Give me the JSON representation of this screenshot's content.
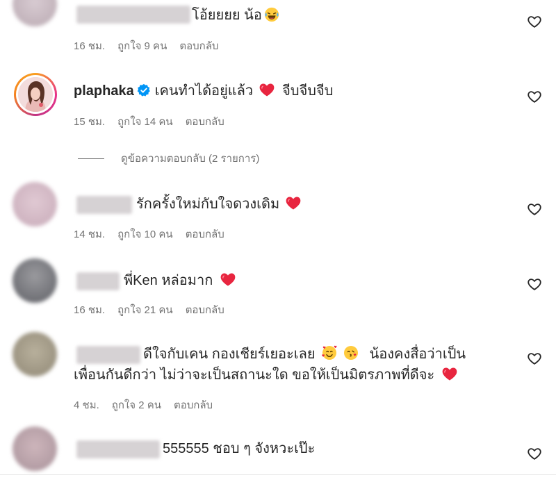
{
  "comments": [
    {
      "text": "โอ้ยยยย น้อ",
      "emoji_after": "laughing-tears",
      "time": "16 ชม.",
      "likes": "ถูกใจ 9 คน",
      "reply": "ตอบกลับ"
    },
    {
      "username": "plaphaka",
      "verified": true,
      "text": "เคนทำได้อยู่แล้ว",
      "text_after": "จีบจีบจีบ",
      "time": "15 ชม.",
      "likes": "ถูกใจ 14 คน",
      "reply": "ตอบกลับ",
      "view_replies": "ดูข้อความตอบกลับ (2 รายการ)"
    },
    {
      "text": "รักครั้งใหม่กับใจดวงเดิม",
      "time": "14 ชม.",
      "likes": "ถูกใจ 10 คน",
      "reply": "ตอบกลับ"
    },
    {
      "text": "พี่Ken หล่อมาก",
      "time": "16 ชม.",
      "likes": "ถูกใจ 21 คน",
      "reply": "ตอบกลับ"
    },
    {
      "text_line1": "ดีใจกับเคน กองเชียร์เยอะเลย",
      "text_line1_after": "น้องคงสื่อว่าเป็น",
      "text_line2": "เพื่อนกันดีกว่า ไม่ว่าจะเป็นสถานะใด ขอให้เป็นมิตรภาพที่ดีจะ",
      "time": "4 ชม.",
      "likes": "ถูกใจ 2 คน",
      "reply": "ตอบกลับ"
    },
    {
      "text": "555555 ชอบ ๆ จังหวะเป๊ะ"
    }
  ],
  "colors": {
    "text": "#262626",
    "meta": "#737373",
    "heart_red": "#e8253f",
    "verified_blue": "#0095f6"
  }
}
